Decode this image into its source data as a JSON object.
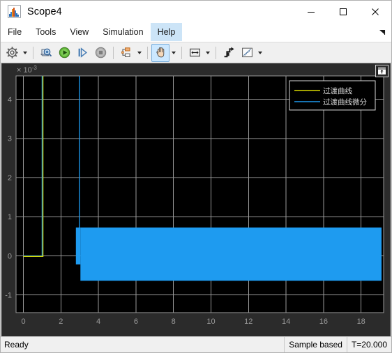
{
  "window": {
    "title": "Scope4",
    "icon": "scope-app-icon",
    "controls": [
      {
        "name": "minimize",
        "glyph": "minimize-icon"
      },
      {
        "name": "maximize",
        "glyph": "maximize-icon"
      },
      {
        "name": "close",
        "glyph": "close-icon"
      }
    ]
  },
  "menubar": {
    "items": [
      {
        "label": "File",
        "active": false
      },
      {
        "label": "Tools",
        "active": false
      },
      {
        "label": "View",
        "active": false
      },
      {
        "label": "Simulation",
        "active": false
      },
      {
        "label": "Help",
        "active": true
      }
    ],
    "overflow_icon": "menu-overflow-arrow-icon"
  },
  "toolbar": {
    "buttons": [
      {
        "name": "configuration-properties",
        "icon": "gear-icon",
        "caret": true,
        "active": false
      },
      {
        "name": "print",
        "icon": "print-preview-icon",
        "caret": false,
        "active": false
      },
      {
        "name": "run",
        "icon": "play-icon",
        "caret": false,
        "active": false
      },
      {
        "name": "step-forward",
        "icon": "step-forward-icon",
        "caret": false,
        "active": false
      },
      {
        "name": "stop",
        "icon": "stop-icon",
        "caret": false,
        "active": false
      },
      {
        "name": "signal-selection",
        "icon": "signal-blocks-icon",
        "caret": true,
        "active": false
      },
      {
        "name": "pan",
        "icon": "hand-pan-icon",
        "caret": true,
        "active": true
      },
      {
        "name": "zoom-fit",
        "icon": "fit-to-view-icon",
        "caret": true,
        "active": false
      },
      {
        "name": "cursor-measurements",
        "icon": "cursor-step-icon",
        "caret": false,
        "active": false
      },
      {
        "name": "measurements",
        "icon": "ruler-icon",
        "caret": true,
        "active": false
      }
    ]
  },
  "scope": {
    "undock_icon": "undock-icon",
    "background": "#2b2b2b",
    "plot_background": "#000000",
    "grid_color": "#9a9a9a",
    "axis_text_color": "#9c9c9c"
  },
  "statusbar": {
    "message": "Ready",
    "mode": "Sample based",
    "time": "T=20.000"
  },
  "chart_data": {
    "type": "line",
    "title": "",
    "xlabel": "",
    "ylabel": "",
    "y_multiplier_label": "× 10",
    "y_multiplier_exponent": "-3",
    "y_scale": 0.001,
    "xlim": [
      0,
      19.6
    ],
    "ylim": [
      -1.45,
      4.6
    ],
    "xticks": [
      0,
      2,
      4,
      6,
      8,
      10,
      12,
      14,
      16,
      18
    ],
    "yticks": [
      4,
      3,
      2,
      1,
      0,
      -1
    ],
    "xtick_labels": [
      "0",
      "2",
      "4",
      "6",
      "8",
      "10",
      "12",
      "14",
      "16",
      "18"
    ],
    "ytick_labels": [
      "4",
      "3",
      "2",
      "1",
      "0",
      "-1"
    ],
    "grid": true,
    "legend_position": "top-right",
    "series": [
      {
        "name": "过渡曲线",
        "color": "#d9d900",
        "description": "Flat at 0 until t=1, then steps up vertically off the top of the visible range",
        "points": [
          [
            0,
            0
          ],
          [
            1.0,
            0
          ],
          [
            1.02,
            4.6
          ]
        ]
      },
      {
        "name": "过渡曲线微分",
        "color": "#1e9bf0",
        "description": "Flat at 0 until t=1, spikes vertically at t=1, stays high until t=3, drops and then oscillates rapidly between about -0.8e-3 and 0.75e-3 from t=3.2 to the end, appearing as a solid filled band",
        "points": [
          [
            0,
            0
          ],
          [
            1.0,
            0
          ],
          [
            1.02,
            4.6
          ],
          [
            3.0,
            4.6
          ],
          [
            3.0,
            0.45
          ],
          [
            3.1,
            -0.4
          ],
          [
            3.2,
            -0.8
          ]
        ],
        "oscillation": {
          "t_start": 3.18,
          "t_end": 19.45,
          "y_min": -0.8,
          "y_max": 0.75,
          "y_min_early": -0.4,
          "t_early_end": 3.32,
          "appearance": "solid-filled-band"
        }
      }
    ]
  }
}
